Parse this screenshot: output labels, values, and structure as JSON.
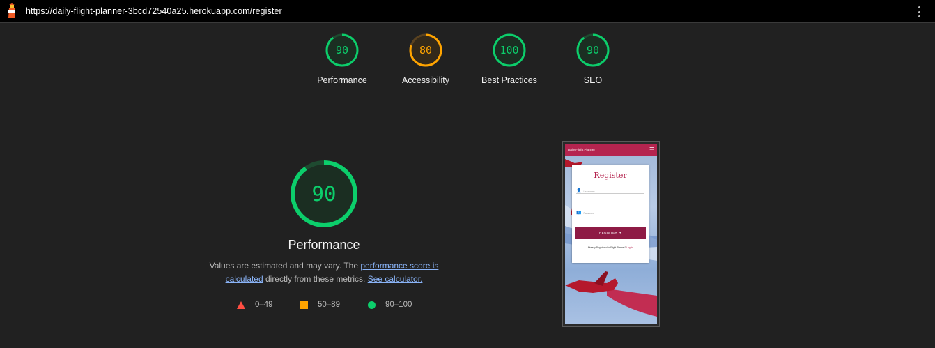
{
  "browser": {
    "url": "https://daily-flight-planner-3bcd72540a25.herokuapp.com/register",
    "logo_icon": "lighthouse-icon",
    "menu_icon": "kebab-menu-icon"
  },
  "colors": {
    "pass": "#0cce6b",
    "average": "#ffa400",
    "fail": "#ff4e42",
    "background": "#212121",
    "link": "#8ab4f8",
    "brand": "#b5244f"
  },
  "summary": {
    "categories": [
      {
        "label": "Performance",
        "score": 90,
        "rating": "pass"
      },
      {
        "label": "Accessibility",
        "score": 80,
        "rating": "average"
      },
      {
        "label": "Best Practices",
        "score": 100,
        "rating": "pass"
      },
      {
        "label": "SEO",
        "score": 90,
        "rating": "pass"
      }
    ]
  },
  "main": {
    "score": 90,
    "title": "Performance",
    "desc_prefix": "Values are estimated and may vary. The ",
    "desc_link1": "performance score is calculated",
    "desc_mid": " directly from these metrics. ",
    "desc_link2": "See calculator.",
    "legend": [
      {
        "range": "0–49",
        "shape": "triangle"
      },
      {
        "range": "50–89",
        "shape": "square"
      },
      {
        "range": "90–100",
        "shape": "circle"
      }
    ]
  },
  "screenshot": {
    "nav_brand": "Daily Flight Planner",
    "card_title": "Register",
    "username_placeholder": "Username",
    "password_placeholder": "Password",
    "button_label": "REGISTER",
    "already_text": "Already Registered to Flight Planner?",
    "login_link": "Log In"
  }
}
